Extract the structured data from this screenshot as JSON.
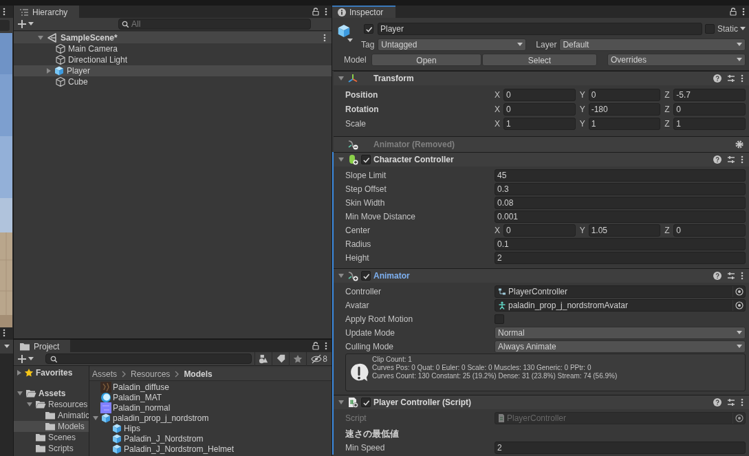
{
  "hierarchy": {
    "tab": {
      "label": "Hierarchy",
      "selected": true,
      "focused": false
    },
    "search": {
      "placeholder": "All"
    },
    "scene": {
      "name": "SampleScene*",
      "expanded": true
    },
    "items": [
      {
        "name": "Main Camera",
        "kind": "object",
        "selected": false
      },
      {
        "name": "Directional Light",
        "kind": "object",
        "selected": false
      },
      {
        "name": "Player",
        "kind": "prefab",
        "selected": true,
        "expanded": false
      },
      {
        "name": "Cube",
        "kind": "object",
        "selected": false
      }
    ]
  },
  "project": {
    "tab": {
      "label": "Project",
      "selected": true,
      "focused": false
    },
    "hidden_count": "8",
    "tree": [
      {
        "name": "Favorites",
        "kind": "favorites",
        "expanded": false,
        "selected": false
      },
      {
        "name": "Assets",
        "kind": "folder",
        "expanded": true,
        "selected": false,
        "children": [
          {
            "name": "Resources",
            "kind": "folder",
            "expanded": true,
            "selected": false,
            "children": [
              {
                "name": "Animatic",
                "kind": "folder",
                "selected": false
              },
              {
                "name": "Models",
                "kind": "folder",
                "selected": true
              }
            ]
          },
          {
            "name": "Scenes",
            "kind": "folder",
            "selected": false
          },
          {
            "name": "Scripts",
            "kind": "folder",
            "selected": false
          }
        ]
      }
    ],
    "breadcrumb": [
      "Assets",
      "Resources",
      "Models"
    ],
    "assets": [
      {
        "name": "Paladin_diffuse",
        "kind": "texture"
      },
      {
        "name": "Paladin_MAT",
        "kind": "material"
      },
      {
        "name": "Paladin_normal",
        "kind": "normal_map"
      },
      {
        "name": "paladin_prop_j_nordstrom",
        "kind": "model",
        "expanded": true,
        "children": [
          {
            "name": "Hips",
            "kind": "prefab"
          },
          {
            "name": "Paladin_J_Nordstrom",
            "kind": "prefab"
          },
          {
            "name": "Paladin_J_Nordstrom_Helmet",
            "kind": "prefab"
          }
        ]
      }
    ]
  },
  "inspector": {
    "tab": {
      "label": "Inspector",
      "selected": true,
      "focused": true
    },
    "object": {
      "name": "Player",
      "active": true,
      "static": false,
      "static_label": "Static",
      "tag_label": "Tag",
      "tag": "Untagged",
      "layer_label": "Layer",
      "layer": "Default",
      "model_label": "Model",
      "model_buttons": [
        "Open",
        "Select"
      ],
      "overrides": "Overrides"
    },
    "components": [
      {
        "kind": "transform",
        "title": "Transform",
        "expanded": true,
        "added": false,
        "title_highlight": false,
        "rows": [
          {
            "kind": "vector",
            "label": "Position",
            "overridden": true,
            "axes": [
              {
                "axis": "X",
                "value": "0"
              },
              {
                "axis": "Y",
                "value": "0"
              },
              {
                "axis": "Z",
                "value": "-5.7"
              }
            ]
          },
          {
            "kind": "vector",
            "label": "Rotation",
            "overridden": true,
            "axes": [
              {
                "axis": "X",
                "value": "0"
              },
              {
                "axis": "Y",
                "value": "-180"
              },
              {
                "axis": "Z",
                "value": "0"
              }
            ]
          },
          {
            "kind": "vector",
            "label": "Scale",
            "overridden": false,
            "axes": [
              {
                "axis": "X",
                "value": "1"
              },
              {
                "axis": "Y",
                "value": "1"
              },
              {
                "axis": "Z",
                "value": "1"
              }
            ]
          }
        ]
      },
      {
        "kind": "removed",
        "title": "Animator (Removed)",
        "added": false
      },
      {
        "kind": "character_controller",
        "title": "Character Controller",
        "expanded": true,
        "enabled": true,
        "added": true,
        "title_highlight": false,
        "rows": [
          {
            "kind": "field",
            "label": "Slope Limit",
            "value": "45"
          },
          {
            "kind": "field",
            "label": "Step Offset",
            "value": "0.3"
          },
          {
            "kind": "field",
            "label": "Skin Width",
            "value": "0.08"
          },
          {
            "kind": "field",
            "label": "Min Move Distance",
            "value": "0.001"
          },
          {
            "kind": "vector",
            "label": "Center",
            "axes": [
              {
                "axis": "X",
                "value": "0"
              },
              {
                "axis": "Y",
                "value": "1.05"
              },
              {
                "axis": "Z",
                "value": "0"
              }
            ]
          },
          {
            "kind": "field",
            "label": "Radius",
            "value": "0.1"
          },
          {
            "kind": "field",
            "label": "Height",
            "value": "2"
          }
        ]
      },
      {
        "kind": "animator",
        "title": "Animator",
        "expanded": true,
        "enabled": true,
        "added": true,
        "title_highlight": true,
        "rows": [
          {
            "kind": "object",
            "label": "Controller",
            "object": {
              "kind": "controller",
              "name": "PlayerController"
            },
            "disabled": false
          },
          {
            "kind": "object",
            "label": "Avatar",
            "object": {
              "kind": "avatar",
              "name": "paladin_prop_j_nordstromAvatar"
            },
            "disabled": false
          },
          {
            "kind": "toggle",
            "label": "Apply Root Motion",
            "checked": false
          },
          {
            "kind": "dropdown",
            "label": "Update Mode",
            "value": "Normal"
          },
          {
            "kind": "dropdown",
            "label": "Culling Mode",
            "value": "Always Animate"
          },
          {
            "kind": "info",
            "lines": [
              "Clip Count: 1",
              "Curves Pos: 0 Quat: 0 Euler: 0 Scale: 0 Muscles: 130 Generic: 0 PPtr: 0",
              "Curves Count: 130 Constant: 25 (19.2%) Dense: 31 (23.8%) Stream: 74 (56.9%)"
            ]
          }
        ]
      },
      {
        "kind": "script",
        "title": "Player Controller (Script)",
        "expanded": true,
        "enabled": true,
        "added": true,
        "title_highlight": false,
        "rows": [
          {
            "kind": "object",
            "label": "Script",
            "object": {
              "kind": "script",
              "name": "PlayerController"
            },
            "disabled": true
          },
          {
            "kind": "header",
            "label": "速さの最低値"
          },
          {
            "kind": "field",
            "label": "Min Speed",
            "value": "2"
          }
        ]
      }
    ]
  }
}
